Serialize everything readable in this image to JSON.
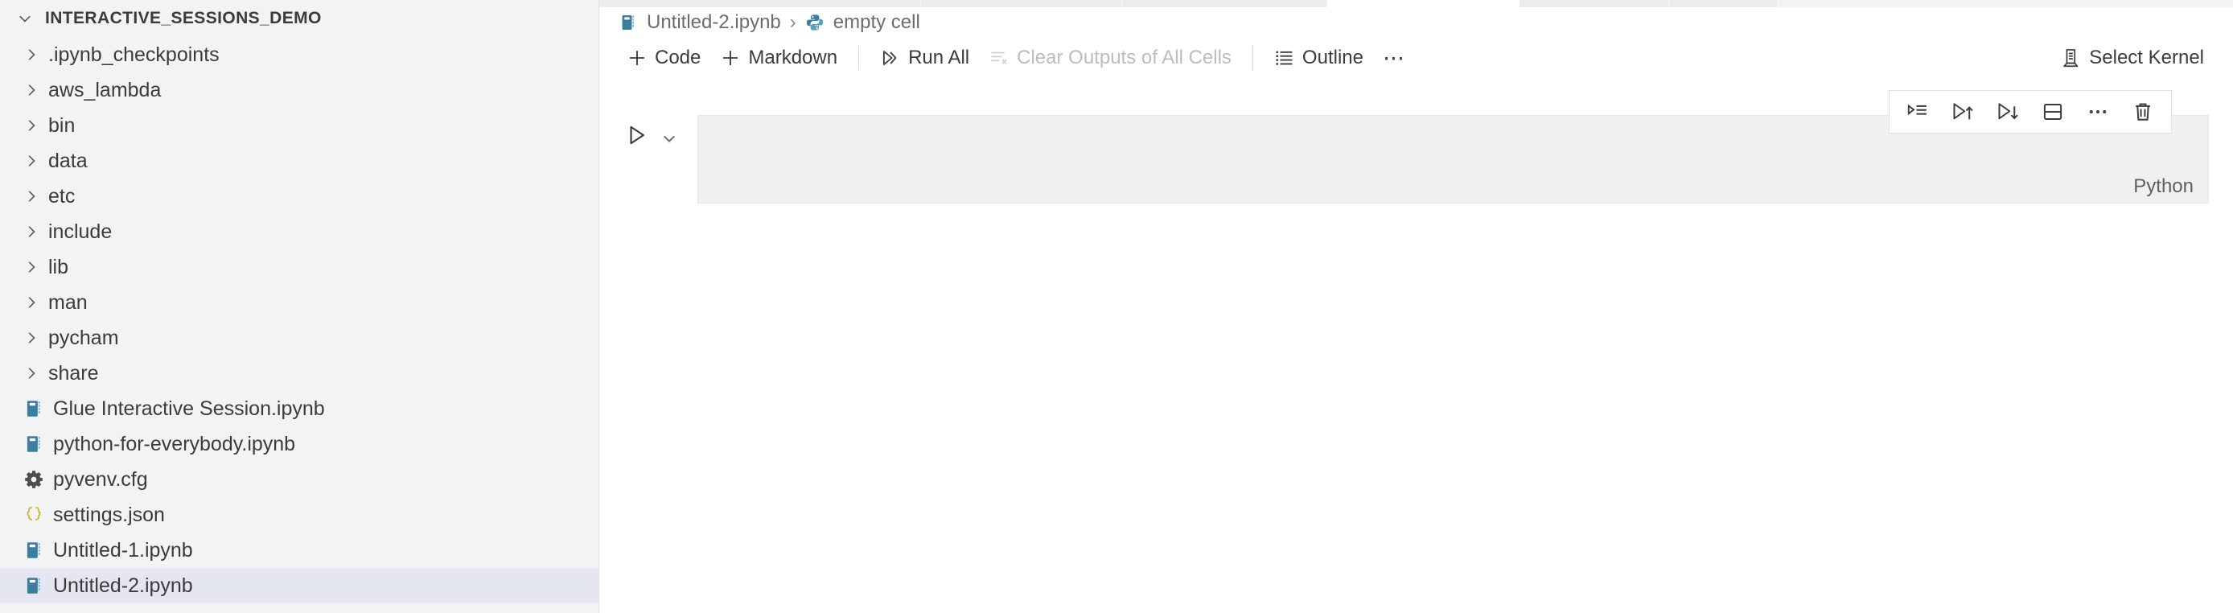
{
  "sidebar": {
    "header": {
      "label": "INTERACTIVE_SESSIONS_DEMO",
      "twisty_icon": "chevron-down-icon"
    },
    "items": [
      {
        "label": ".ipynb_checkpoints",
        "kind": "folder",
        "icon": "chevron-right-icon",
        "selected": false
      },
      {
        "label": "aws_lambda",
        "kind": "folder",
        "icon": "chevron-right-icon",
        "selected": false
      },
      {
        "label": "bin",
        "kind": "folder",
        "icon": "chevron-right-icon",
        "selected": false
      },
      {
        "label": "data",
        "kind": "folder",
        "icon": "chevron-right-icon",
        "selected": false
      },
      {
        "label": "etc",
        "kind": "folder",
        "icon": "chevron-right-icon",
        "selected": false
      },
      {
        "label": "include",
        "kind": "folder",
        "icon": "chevron-right-icon",
        "selected": false
      },
      {
        "label": "lib",
        "kind": "folder",
        "icon": "chevron-right-icon",
        "selected": false
      },
      {
        "label": "man",
        "kind": "folder",
        "icon": "chevron-right-icon",
        "selected": false
      },
      {
        "label": "pycham",
        "kind": "folder",
        "icon": "chevron-right-icon",
        "selected": false
      },
      {
        "label": "share",
        "kind": "folder",
        "icon": "chevron-right-icon",
        "selected": false
      },
      {
        "label": "Glue Interactive Session.ipynb",
        "kind": "file",
        "icon": "notebook-icon",
        "selected": false
      },
      {
        "label": "python-for-everybody.ipynb",
        "kind": "file",
        "icon": "notebook-icon",
        "selected": false
      },
      {
        "label": "pyvenv.cfg",
        "kind": "file",
        "icon": "gear-icon",
        "selected": false
      },
      {
        "label": "settings.json",
        "kind": "file",
        "icon": "json-braces-icon",
        "selected": false
      },
      {
        "label": "Untitled-1.ipynb",
        "kind": "file",
        "icon": "notebook-icon",
        "selected": false
      },
      {
        "label": "Untitled-2.ipynb",
        "kind": "file",
        "icon": "notebook-icon",
        "selected": true
      }
    ]
  },
  "breadcrumb": {
    "file_icon": "notebook-icon",
    "file": "Untitled-2.ipynb",
    "separator": "›",
    "cell_icon": "python-icon",
    "cell": "empty cell"
  },
  "toolbar": {
    "add_code": "Code",
    "add_markdown": "Markdown",
    "run_all": "Run All",
    "clear_outputs": "Clear Outputs of All Cells",
    "clear_outputs_disabled": true,
    "outline": "Outline",
    "more": "⋯",
    "select_kernel": "Select Kernel"
  },
  "cell_toolbar": {
    "buttons": [
      {
        "icon": "run-by-line-icon",
        "title": "Run by Line"
      },
      {
        "icon": "run-above-icon",
        "title": "Execute Above Cells"
      },
      {
        "icon": "run-below-icon",
        "title": "Execute Cell and Below"
      },
      {
        "icon": "split-cell-icon",
        "title": "Split Cell"
      },
      {
        "icon": "more-actions-icon",
        "title": "More Actions..."
      },
      {
        "icon": "trash-icon",
        "title": "Delete Cell"
      }
    ]
  },
  "cell": {
    "run_icon": "play-icon",
    "chevron_icon": "chevron-down-icon",
    "content": "",
    "language": "Python"
  },
  "colors": {
    "sidebar_bg": "#f3f3f3",
    "editor_bg": "#ffffff",
    "selection_bg": "#e4e6f1",
    "cell_bg": "#f0f0f0",
    "notebook_icon": "#3b7fa0",
    "json_icon": "#cbb42e",
    "text": "#3b3b3b",
    "muted_text": "#6c6c6c",
    "disabled_text": "#bcbcbc"
  }
}
